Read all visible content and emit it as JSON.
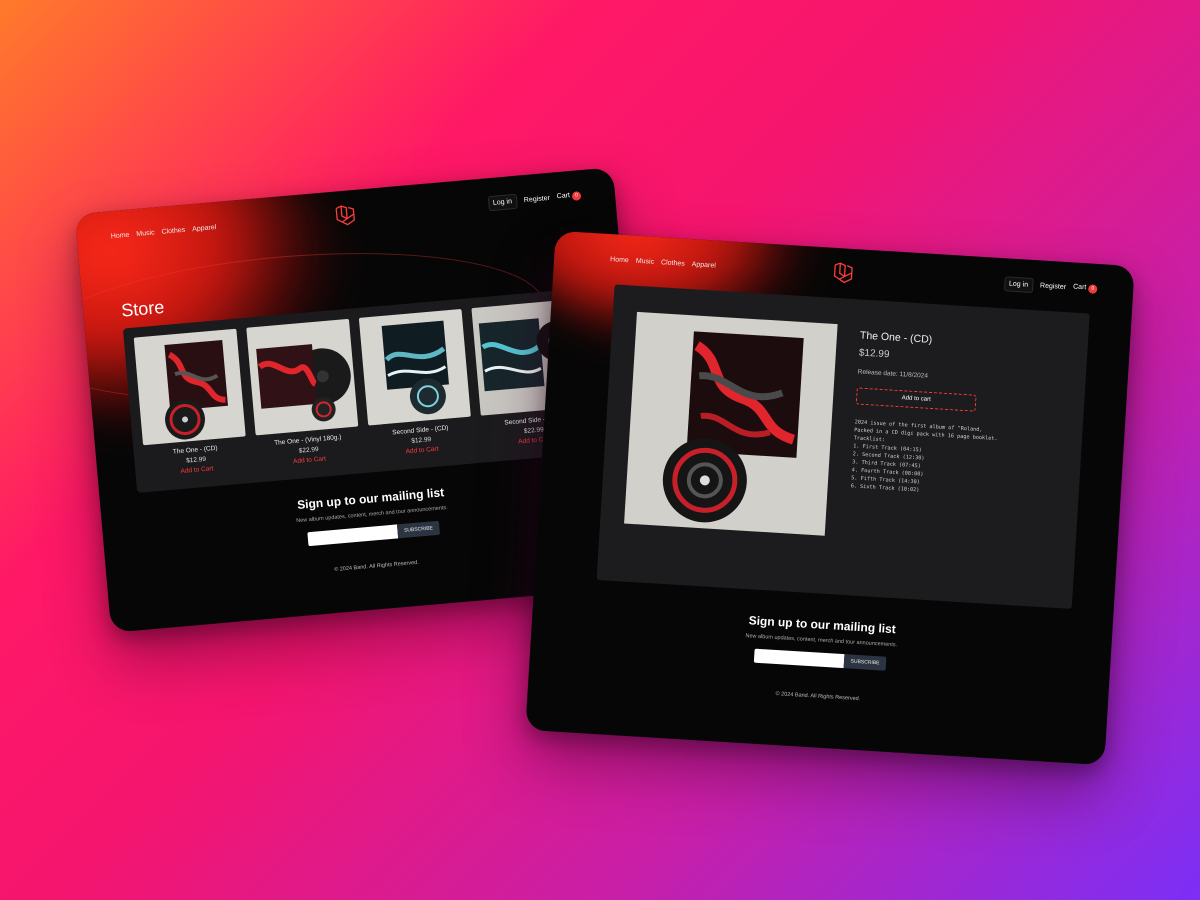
{
  "store_screen": {
    "nav": [
      "Home",
      "Music",
      "Clothes",
      "Apparel"
    ],
    "auth": {
      "login": "Log in",
      "register": "Register",
      "cart": "Cart",
      "cart_count": "0"
    },
    "title": "Store",
    "products": [
      {
        "name": "The One - (CD)",
        "price": "$12.99",
        "action": "Add to Cart"
      },
      {
        "name": "The One - (Vinyl 180g.)",
        "price": "$22.99",
        "action": "Add to Cart"
      },
      {
        "name": "Second Side - (CD)",
        "price": "$12.99",
        "action": "Add to Cart"
      },
      {
        "name": "Second Side - (Viny",
        "price": "$22.99",
        "action": "Add to Cart"
      }
    ],
    "mailing": {
      "heading": "Sign up to our mailing list",
      "text": "New album updates, content, merch and tour announcements.",
      "button": "SUBSCRIBE"
    },
    "footer": "© 2024 Band. All Rights Reserved."
  },
  "detail_screen": {
    "nav": [
      "Home",
      "Music",
      "Clothes",
      "Apparel"
    ],
    "auth": {
      "login": "Log in",
      "register": "Register",
      "cart": "Cart",
      "cart_count": "0"
    },
    "product": {
      "title": "The One - (CD)",
      "price": "$12.99",
      "release": "Release date: 11/8/2024",
      "button": "Add to cart",
      "description": "2024 issue of the first album of \"Roland,\nPacked in a CD digi pack with 16 page booklet.\nTracklist:\n1. First Track (04:15)\n2. Second Track (12:30)\n3. Third Track (07:45)\n4. Fourth Track (08:00)\n5. Fifth Track (14:30)\n6. Sixth Track (10:02)"
    },
    "mailing": {
      "heading": "Sign up to our mailing list",
      "text": "New album updates, content, merch and tour announcements.",
      "button": "SUBSCRIBE"
    },
    "footer": "© 2024 Band. All Rights Reserved."
  },
  "colors": {
    "accent": "#ff3c3c",
    "bg_gradient_start": "#ff7a2a",
    "bg_gradient_mid": "#ff1866",
    "bg_gradient_end": "#7b2ff7",
    "panel": "#1b1b1d"
  },
  "icons": {
    "logo": "laravel-logo-icon"
  }
}
